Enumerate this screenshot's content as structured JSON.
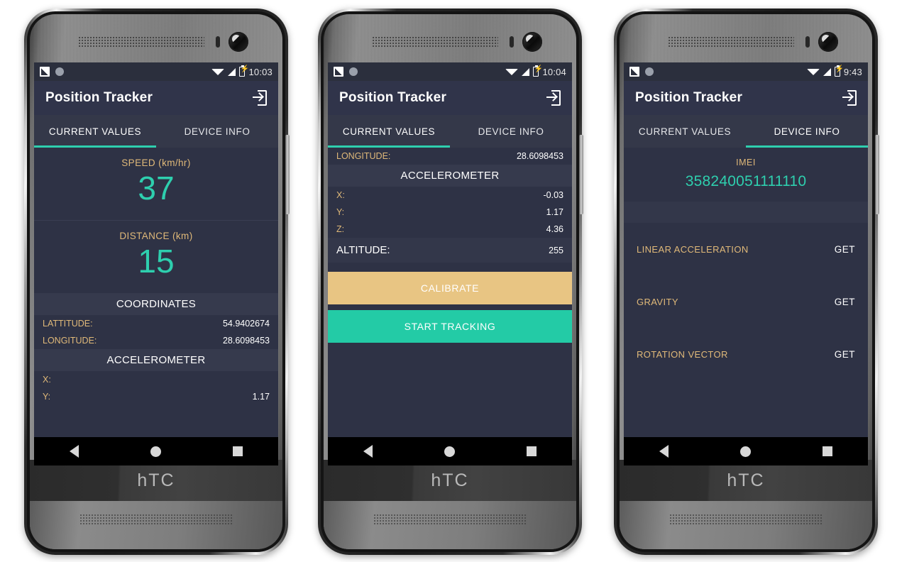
{
  "app": {
    "title": "Position Tracker",
    "brand": "hTC",
    "accent_teal": "#2ecfae",
    "accent_gold": "#e0b979",
    "calibrate_color": "#e8c583",
    "bg_dark": "#2e3245",
    "appbar_color": "#30344a"
  },
  "icons": {
    "logout": "logout-icon",
    "fab": "envelope-icon",
    "status_screenshot": "screenshot-icon",
    "status_circle": "circle-icon",
    "wifi": "wifi-icon",
    "signal": "signal-icon",
    "battery": "battery-charging-icon",
    "nav_back": "back-triangle-icon",
    "nav_home": "home-circle-icon",
    "nav_recents": "recents-square-icon"
  },
  "tabs": {
    "current_values": "CURRENT VALUES",
    "device_info": "DEVICE INFO"
  },
  "phone1": {
    "status_time": "10:03",
    "active_tab": "CURRENT VALUES",
    "speed": {
      "label": "SPEED (km/hr)",
      "value": "37"
    },
    "distance": {
      "label": "DISTANCE (km)",
      "value": "15"
    },
    "coordinates_header": "COORDINATES",
    "coordinates": [
      {
        "key": "LATTITUDE:",
        "value": "54.9402674"
      },
      {
        "key": "LONGITUDE:",
        "value": "28.6098453"
      }
    ],
    "accelerometer_header": "ACCELEROMETER",
    "accelerometer": [
      {
        "key": "X:",
        "value": ""
      },
      {
        "key": "Y:",
        "value": "1.17"
      }
    ]
  },
  "phone2": {
    "status_time": "10:04",
    "active_tab": "CURRENT VALUES",
    "longitude": {
      "key": "LONGITUDE:",
      "value": "28.6098453"
    },
    "accelerometer_header": "ACCELEROMETER",
    "accelerometer": [
      {
        "key": "X:",
        "value": "-0.03"
      },
      {
        "key": "Y:",
        "value": "1.17"
      },
      {
        "key": "Z:",
        "value": "4.36"
      }
    ],
    "altitude": {
      "key": "ALTITUDE:",
      "value": "255"
    },
    "calibrate_label": "CALIBRATE",
    "track_label": "START TRACKING"
  },
  "phone3": {
    "status_time": "9:43",
    "active_tab": "DEVICE INFO",
    "imei_label": "IMEI",
    "imei_value": "358240051111110",
    "sensors": [
      {
        "name": "LINEAR ACCELERATION",
        "action": "GET"
      },
      {
        "name": "GRAVITY",
        "action": "GET"
      },
      {
        "name": "ROTATION VECTOR",
        "action": "GET"
      }
    ]
  }
}
